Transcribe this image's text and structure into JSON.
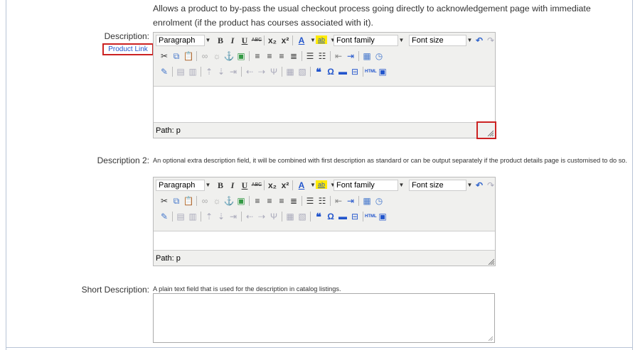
{
  "intro_text": "Allows a product to by-pass the usual checkout process going directly to acknowledgement page with immediate enrolment (if the product has courses associated with it).",
  "fields": {
    "description": {
      "label": "Description:",
      "product_link": "Product Link",
      "path_label": "Path: p"
    },
    "description2": {
      "label": "Description 2:",
      "help": "An optional extra description field, it will be combined with first description as standard or can be output separately if the product details page is customised to do so.",
      "path_label": "Path: p"
    },
    "short_description": {
      "label": "Short Description:",
      "help": "A plain text field that is used for the description in catalog listings.",
      "value": ""
    }
  },
  "toolbar": {
    "format_select": "Paragraph",
    "font_family": "Font family",
    "font_size": "Font size",
    "bold": "B",
    "italic": "I",
    "underline": "U",
    "strikethrough": "ABC",
    "subscript": "x₂",
    "superscript": "x²",
    "font_color": "A",
    "highlight": "ab",
    "quote": "❝",
    "omega": "Ω",
    "html": "HTML"
  },
  "colors": {
    "accent_red": "#cc2222",
    "link_blue": "#2255cc",
    "frame": "#b8c4d6"
  }
}
